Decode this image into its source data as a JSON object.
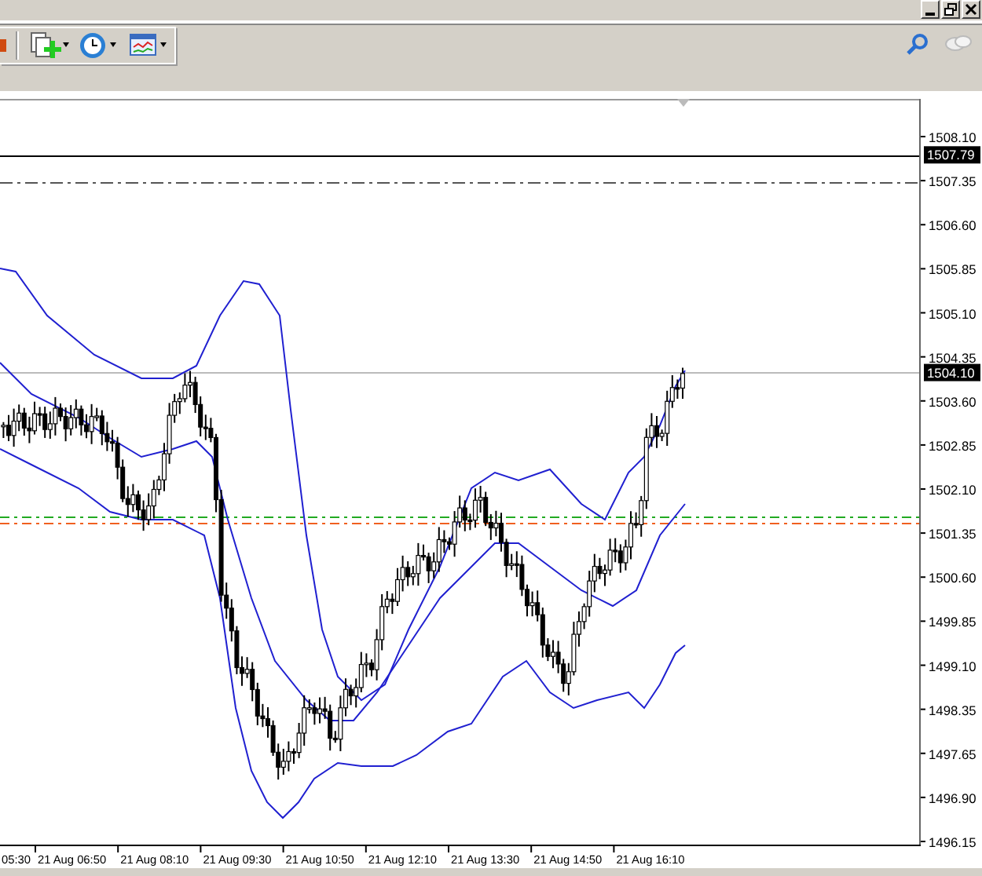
{
  "price_axis": {
    "labels": [
      {
        "text": "1508.10",
        "kind": "tick"
      },
      {
        "text": "1507.79",
        "kind": "marker"
      },
      {
        "text": "1507.35",
        "kind": "tick"
      },
      {
        "text": "1506.60",
        "kind": "tick"
      },
      {
        "text": "1505.85",
        "kind": "tick"
      },
      {
        "text": "1505.10",
        "kind": "tick"
      },
      {
        "text": "1504.35",
        "kind": "tick"
      },
      {
        "text": "1504.10",
        "kind": "marker"
      },
      {
        "text": "1503.60",
        "kind": "tick"
      },
      {
        "text": "1502.85",
        "kind": "tick"
      },
      {
        "text": "1502.10",
        "kind": "tick"
      },
      {
        "text": "1501.35",
        "kind": "tick"
      },
      {
        "text": "1500.60",
        "kind": "tick"
      },
      {
        "text": "1499.85",
        "kind": "tick"
      },
      {
        "text": "1499.10",
        "kind": "tick"
      },
      {
        "text": "1498.35",
        "kind": "tick"
      },
      {
        "text": "1497.65",
        "kind": "tick"
      },
      {
        "text": "1496.90",
        "kind": "tick"
      },
      {
        "text": "1496.15",
        "kind": "tick"
      }
    ]
  },
  "time_axis": {
    "labels": [
      "05:30",
      "21 Aug 06:50",
      "21 Aug 08:10",
      "21 Aug 09:30",
      "21 Aug 10:50",
      "21 Aug 12:10",
      "21 Aug 13:30",
      "21 Aug 14:50",
      "21 Aug 16:10"
    ]
  }
}
